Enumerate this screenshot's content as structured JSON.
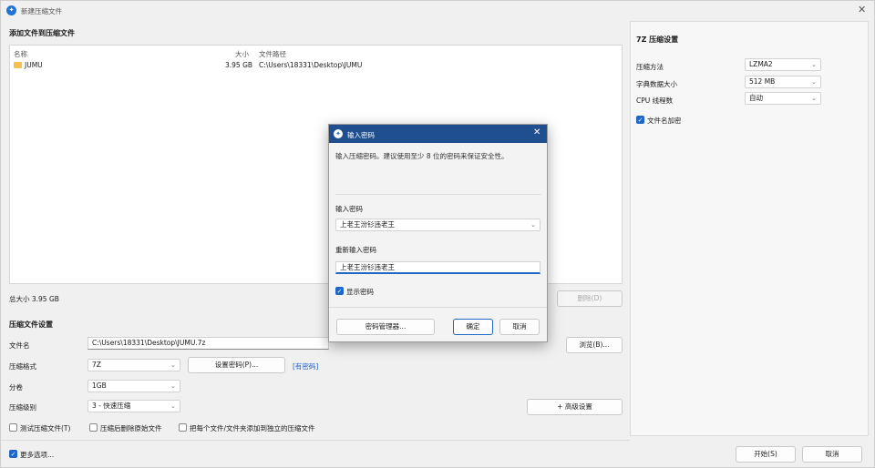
{
  "window": {
    "title": "新建压缩文件"
  },
  "files_section": {
    "title": "添加文件到压缩文件",
    "columns": [
      "名称",
      "大小",
      "文件路径"
    ],
    "rows": [
      {
        "name": "JUMU",
        "size": "3.95 GB",
        "path": "C:\\Users\\18331\\Desktop\\JUMU"
      }
    ],
    "total": "总大小 3.95 GB",
    "delete_label": "删除(D)"
  },
  "settings_section": {
    "title": "压缩文件设置",
    "filename_label": "文件名",
    "filename_value": "C:\\Users\\18331\\Desktop\\JUMU.7z",
    "browse_label": "浏览(B)...",
    "format_label": "压缩格式",
    "format_value": "7Z",
    "set_password_label": "设置密码(P)...",
    "encrypted_badge": "[有密码]",
    "volume_label": "分卷",
    "volume_value": "1GB",
    "level_label": "压缩级别",
    "level_value": "3 - 快速压缩",
    "advanced_label": "+ 高级设置",
    "test_label": "测试压缩文件(T)",
    "delete_after_label": "压缩后删除原始文件",
    "separate_label": "把每个文件/文件夹添加到独立的压缩文件"
  },
  "footer": {
    "more_options_label": "更多选项...",
    "start_label": "开始(S)",
    "cancel_label": "取消"
  },
  "right_panel": {
    "title": "7Z 压缩设置",
    "method_label": "压缩方法",
    "method_value": "LZMA2",
    "dict_label": "字典数据大小",
    "dict_value": "512 MB",
    "cpu_label": "CPU 线程数",
    "cpu_value": "自动",
    "encrypt_names_label": "文件名加密"
  },
  "dialog": {
    "title": "输入密码",
    "hint": "输入压缩密码。建议使用至少 8 位的密码来保证安全性。",
    "password_label": "输入密码",
    "password_value": "上老王汾钐违老王",
    "confirm_label": "重新输入密码",
    "confirm_value": "上老王汾钐违老王",
    "show_password_label": "显示密码",
    "manager_label": "密码管理器...",
    "ok_label": "确定",
    "cancel_label": "取消"
  },
  "colors": {
    "accent": "#1e66c8",
    "dialog_title": "#1f4f8f"
  }
}
